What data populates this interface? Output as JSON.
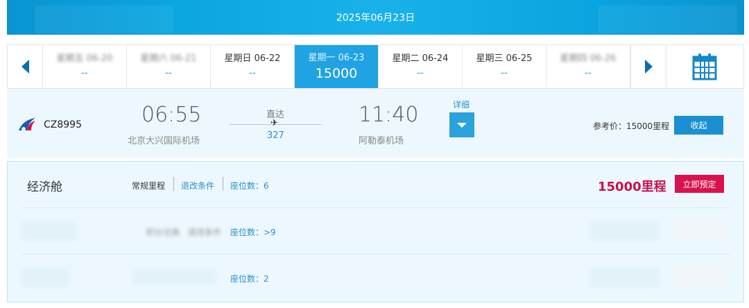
{
  "banner": {
    "date": "2025年06月23日"
  },
  "date_bar": {
    "days": [
      {
        "label": "星期五 06-20",
        "price": "--",
        "obscured": true
      },
      {
        "label": "星期六 06-21",
        "price": "--",
        "obscured": true
      },
      {
        "label": "星期日  06-22",
        "price": "--",
        "obscured": false
      },
      {
        "label": "星期一  06-23",
        "price": "15000",
        "obscured": false,
        "active": true
      },
      {
        "label": "星期二  06-24",
        "price": "--",
        "obscured": false
      },
      {
        "label": "星期三  06-25",
        "price": "--",
        "obscured": false
      },
      {
        "label": "星期四 06-26",
        "price": "--",
        "obscured": true
      }
    ]
  },
  "flight": {
    "number": "CZ8995",
    "dep_time": "06:55",
    "dep_airport": "北京大兴国际机场",
    "stop_type": "直达",
    "plane_glyph": "✈",
    "aircraft": "327",
    "arr_time": "11:40",
    "arr_airport": "阿勒泰机场",
    "detail_label": "详细",
    "ref_price": "参考价：15000里程",
    "collapse_label": "收起"
  },
  "cabin": {
    "class_name": "经济舱",
    "fares": [
      {
        "fare_type": "常规里程",
        "rules_label": "退改条件",
        "seats": "座位数：6",
        "price": "15000里程",
        "book_label": "立即预定"
      },
      {
        "fare_type": "积分兑换",
        "rules_label": "退改条件",
        "seats": "座位数：>9"
      },
      {
        "seats": "座位数：2"
      }
    ]
  },
  "colors": {
    "brand_blue": "#1a8fd2",
    "active_tab": "#1fa3e2",
    "price_red": "#c8104f",
    "book_red": "#d9124f"
  }
}
